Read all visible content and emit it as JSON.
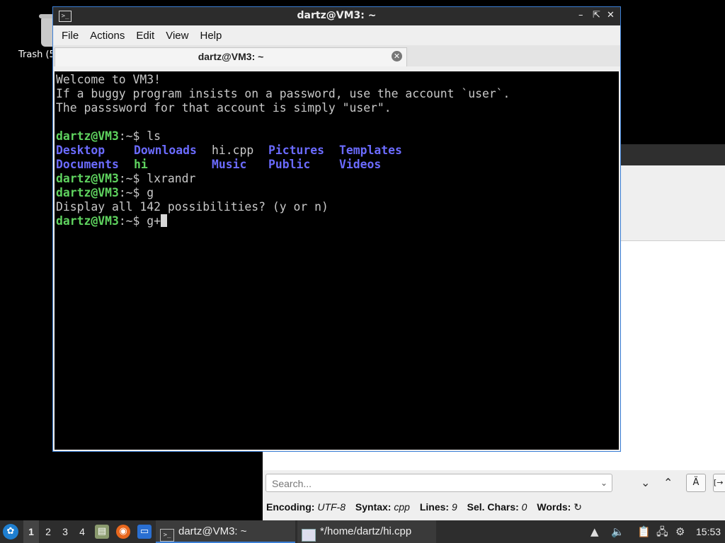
{
  "desktop": {
    "trash_label": "Trash (5"
  },
  "terminal": {
    "title": "dartz@VM3: ~",
    "menu": [
      "File",
      "Actions",
      "Edit",
      "View",
      "Help"
    ],
    "tab_label": "dartz@VM3: ~",
    "prompt_user": "dartz@VM3",
    "prompt_path": ":~$ ",
    "welcome": [
      "Welcome to VM3!",
      "If a buggy program insists on a password, use the account `user`.",
      "The passsword for that account is simply \"user\"."
    ],
    "cmd1": "ls",
    "ls_row1": [
      "Desktop",
      "Downloads",
      "hi.cpp",
      "Pictures",
      "Templates"
    ],
    "ls_row2": [
      "Documents",
      "hi",
      "Music",
      "Public",
      "Videos"
    ],
    "cmd2": "lxrandr",
    "cmd3": "g",
    "completion_msg": "Display all 142 possibilities? (y or n)",
    "cmd4": "g+"
  },
  "editor": {
    "search_placeholder": "Search...",
    "status": {
      "encoding_label": "Encoding:",
      "encoding_value": "UTF-8",
      "syntax_label": "Syntax:",
      "syntax_value": "cpp",
      "lines_label": "Lines:",
      "lines_value": "9",
      "sel_label": "Sel. Chars:",
      "sel_value": "0",
      "words_label": "Words:"
    }
  },
  "taskbar": {
    "workspaces": [
      "1",
      "2",
      "3",
      "4"
    ],
    "active_workspace": "1",
    "tasks": [
      {
        "label": "dartz@VM3: ~",
        "icon": "terminal-icon",
        "active": true
      },
      {
        "label": "*/home/dartz/hi.cpp",
        "icon": "text-editor-icon",
        "active": false
      }
    ],
    "clock": "15:53"
  }
}
